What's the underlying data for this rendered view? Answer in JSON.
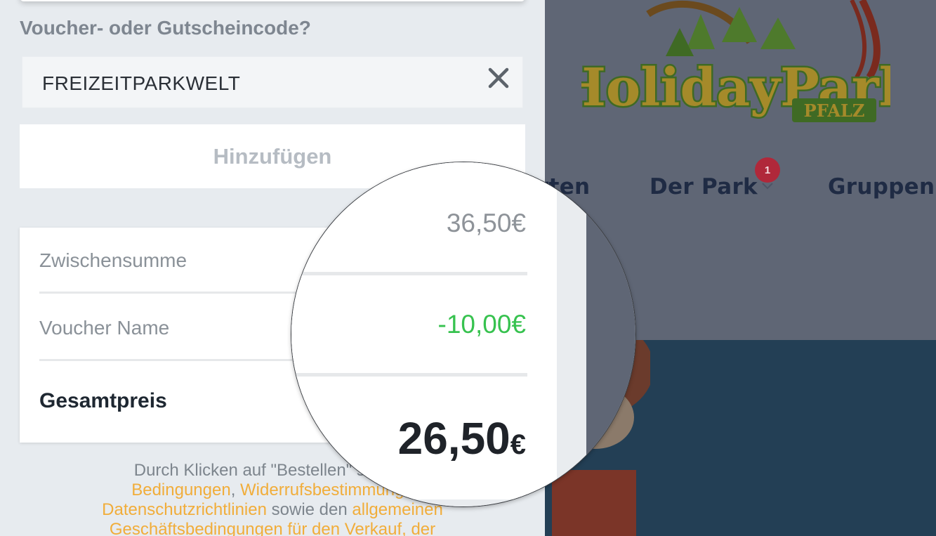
{
  "voucher": {
    "heading": "Voucher- oder Gutscheincode?",
    "code_value": "FREIZEITPARKWELT",
    "clear_icon": "close-icon",
    "add_button_label": "Hinzufügen"
  },
  "summary": {
    "subtotal_label": "Zwischensumme",
    "subtotal_value": "36,50€",
    "discount_label": "Voucher Name",
    "discount_value": "-10,00€",
    "total_label": "Gesamtpreis",
    "total_amount": "26,50",
    "total_currency": "€"
  },
  "legal": {
    "line1": "Durch Klicken auf \"Bestellen\" stimme",
    "link_conditions": "Bedingungen",
    "comma": ",",
    "link_withdrawal": "Widerrufsbestimmunge",
    "link_privacy": "Datenschutzrichtlinien",
    "text_and": "sowie den",
    "link_general": "allgemeinen",
    "link_terms": "Geschäftsbedingungen für den Verkauf",
    "text_tail": ", der"
  },
  "site": {
    "logo_text": "HolidayPark",
    "logo_subtext": "PFALZ",
    "nav_partial": "rten",
    "nav_park": "Der Park",
    "nav_park_badge": "1",
    "nav_groups": "Gruppen"
  },
  "colors": {
    "discount_green": "#37c24f",
    "link_orange": "#f1ad3a",
    "badge_red": "#b0283a",
    "nav_dark": "#1f2b44"
  }
}
